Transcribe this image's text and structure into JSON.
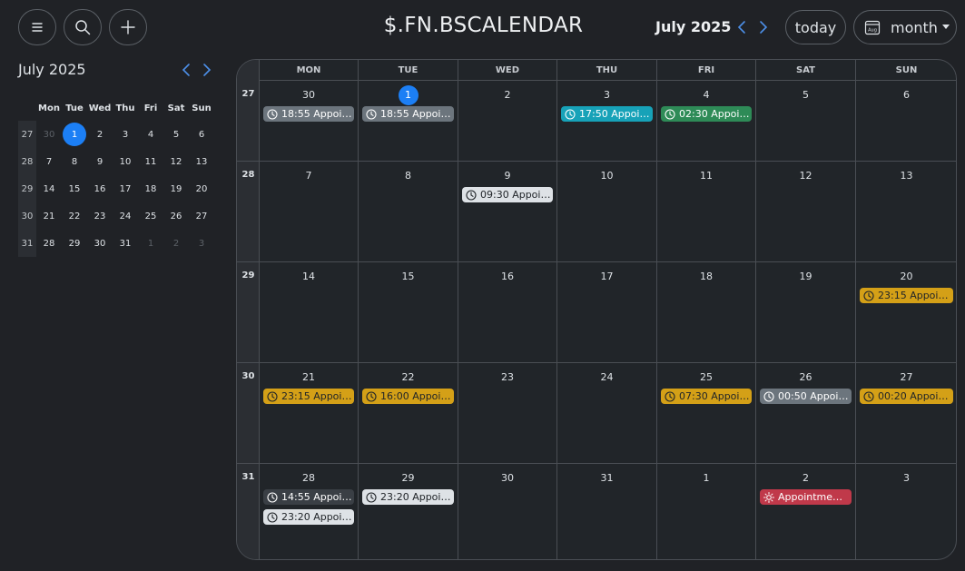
{
  "app_title": "$.FN.BSCALENDAR",
  "header": {
    "month_label": "July 2025",
    "today_label": "today",
    "view_label": "month",
    "view_icon_text": "Aug"
  },
  "mini": {
    "title": "July 2025",
    "day_names": [
      "Mon",
      "Tue",
      "Wed",
      "Thu",
      "Fri",
      "Sat",
      "Sun"
    ],
    "weeks": [
      {
        "num": "27",
        "days": [
          {
            "d": "30",
            "muted": true
          },
          {
            "d": "1",
            "today": true
          },
          {
            "d": "2"
          },
          {
            "d": "3"
          },
          {
            "d": "4"
          },
          {
            "d": "5"
          },
          {
            "d": "6"
          }
        ]
      },
      {
        "num": "28",
        "days": [
          {
            "d": "7"
          },
          {
            "d": "8"
          },
          {
            "d": "9"
          },
          {
            "d": "10"
          },
          {
            "d": "11"
          },
          {
            "d": "12"
          },
          {
            "d": "13"
          }
        ]
      },
      {
        "num": "29",
        "days": [
          {
            "d": "14"
          },
          {
            "d": "15"
          },
          {
            "d": "16"
          },
          {
            "d": "17"
          },
          {
            "d": "18"
          },
          {
            "d": "19"
          },
          {
            "d": "20"
          }
        ]
      },
      {
        "num": "30",
        "days": [
          {
            "d": "21"
          },
          {
            "d": "22"
          },
          {
            "d": "23"
          },
          {
            "d": "24"
          },
          {
            "d": "25"
          },
          {
            "d": "26"
          },
          {
            "d": "27"
          }
        ]
      },
      {
        "num": "31",
        "days": [
          {
            "d": "28"
          },
          {
            "d": "29"
          },
          {
            "d": "30"
          },
          {
            "d": "31"
          },
          {
            "d": "1",
            "muted": true
          },
          {
            "d": "2",
            "muted": true
          },
          {
            "d": "3",
            "muted": true
          }
        ]
      }
    ]
  },
  "calendar": {
    "day_names": [
      "MON",
      "TUE",
      "WED",
      "THU",
      "FRI",
      "SAT",
      "SUN"
    ],
    "weeks": [
      {
        "num": "27",
        "days": [
          {
            "d": "30",
            "events": [
              {
                "text": "18:55 Appoi…",
                "color": "#6c757d",
                "fg": "#ffffff",
                "icon": "clock-icon"
              }
            ]
          },
          {
            "d": "1",
            "today": true,
            "events": [
              {
                "text": "18:55 Appoi…",
                "color": "#6c757d",
                "fg": "#ffffff",
                "icon": "clock-icon"
              }
            ]
          },
          {
            "d": "2",
            "events": []
          },
          {
            "d": "3",
            "events": [
              {
                "text": "17:50 Appoi…",
                "color": "#17a2b8",
                "fg": "#ffffff",
                "icon": "clock-icon"
              }
            ]
          },
          {
            "d": "4",
            "events": [
              {
                "text": "02:30 Appoi…",
                "color": "#2e8b57",
                "fg": "#ffffff",
                "icon": "clock-icon"
              }
            ]
          },
          {
            "d": "5",
            "events": []
          },
          {
            "d": "6",
            "events": []
          }
        ]
      },
      {
        "num": "28",
        "days": [
          {
            "d": "7",
            "events": []
          },
          {
            "d": "8",
            "events": []
          },
          {
            "d": "9",
            "events": [
              {
                "text": "09:30 Appoi…",
                "color": "#dee2e6",
                "fg": "#212529",
                "icon": "clock-icon"
              }
            ]
          },
          {
            "d": "10",
            "events": []
          },
          {
            "d": "11",
            "events": []
          },
          {
            "d": "12",
            "events": []
          },
          {
            "d": "13",
            "events": []
          }
        ]
      },
      {
        "num": "29",
        "days": [
          {
            "d": "14",
            "events": []
          },
          {
            "d": "15",
            "events": []
          },
          {
            "d": "16",
            "events": []
          },
          {
            "d": "17",
            "events": []
          },
          {
            "d": "18",
            "events": []
          },
          {
            "d": "19",
            "events": []
          },
          {
            "d": "20",
            "events": [
              {
                "text": "23:15 Appoi…",
                "color": "#d4a017",
                "fg": "#212529",
                "icon": "clock-icon"
              }
            ]
          }
        ]
      },
      {
        "num": "30",
        "days": [
          {
            "d": "21",
            "events": [
              {
                "text": "23:15 Appoi…",
                "color": "#d4a017",
                "fg": "#212529",
                "icon": "clock-icon"
              }
            ]
          },
          {
            "d": "22",
            "events": [
              {
                "text": "16:00 Appoi…",
                "color": "#d4a017",
                "fg": "#212529",
                "icon": "clock-icon"
              }
            ]
          },
          {
            "d": "23",
            "events": []
          },
          {
            "d": "24",
            "events": []
          },
          {
            "d": "25",
            "events": [
              {
                "text": "07:30 Appoi…",
                "color": "#d4a017",
                "fg": "#212529",
                "icon": "clock-icon"
              }
            ]
          },
          {
            "d": "26",
            "events": [
              {
                "text": "00:50 Appoi…",
                "color": "#6c757d",
                "fg": "#ffffff",
                "icon": "clock-icon"
              }
            ]
          },
          {
            "d": "27",
            "events": [
              {
                "text": "00:20 Appoi…",
                "color": "#d4a017",
                "fg": "#212529",
                "icon": "clock-icon"
              }
            ]
          }
        ]
      },
      {
        "num": "31",
        "days": [
          {
            "d": "28",
            "events": [
              {
                "text": "14:55 Appoi…",
                "color": "#3a3f45",
                "fg": "#ffffff",
                "icon": "clock-icon"
              },
              {
                "text": "23:20 Appoi…",
                "color": "#dee2e6",
                "fg": "#212529",
                "icon": "clock-icon"
              }
            ]
          },
          {
            "d": "29",
            "events": [
              {
                "text": "23:20 Appoi…",
                "color": "#dee2e6",
                "fg": "#212529",
                "icon": "clock-icon"
              }
            ]
          },
          {
            "d": "30",
            "events": []
          },
          {
            "d": "31",
            "events": []
          },
          {
            "d": "1",
            "events": []
          },
          {
            "d": "2",
            "events": [
              {
                "text": "Appointme…",
                "color": "#c0394a",
                "fg": "#ffffff",
                "icon": "sun-icon"
              }
            ]
          },
          {
            "d": "3",
            "events": []
          }
        ]
      }
    ]
  }
}
